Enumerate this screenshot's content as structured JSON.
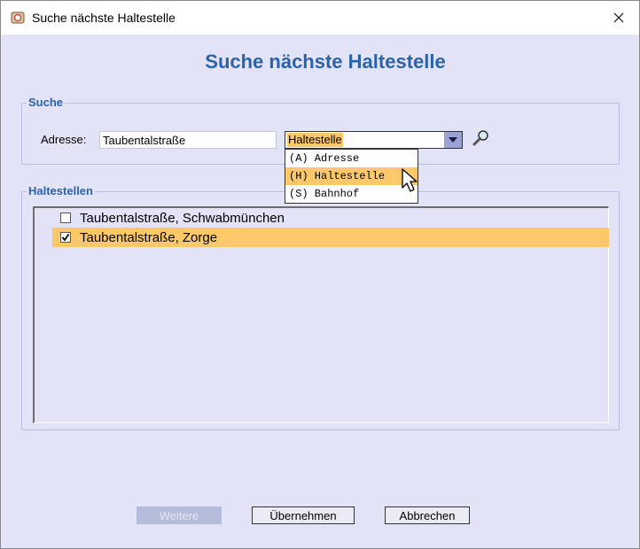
{
  "window": {
    "title": "Suche nächste Haltestelle",
    "close_glyph": "✕"
  },
  "heading": "Suche nächste Haltestelle",
  "search": {
    "legend": "Suche",
    "address_label": "Adresse:",
    "address_value": "Taubentalstraße",
    "type_select_value": "Haltestelle",
    "options": [
      "(A) Adresse",
      "(H) Haltestelle",
      "(S) Bahnhof"
    ],
    "selected_option_index": 1
  },
  "stops": {
    "legend": "Haltestellen",
    "items": [
      {
        "label": "Taubentalstraße, Schwabmünchen",
        "checked": false
      },
      {
        "label": "Taubentalstraße, Zorge",
        "checked": true
      }
    ]
  },
  "buttons": {
    "more": "Weitere",
    "apply": "Übernehmen",
    "cancel": "Abbrechen"
  },
  "colors": {
    "accent": "#2a63a8",
    "selection": "#fcc86a",
    "background": "#e3e3f7"
  },
  "icons": [
    "app-icon",
    "close-icon",
    "chevron-down-icon",
    "magnifier-icon",
    "pointer-cursor-icon"
  ]
}
